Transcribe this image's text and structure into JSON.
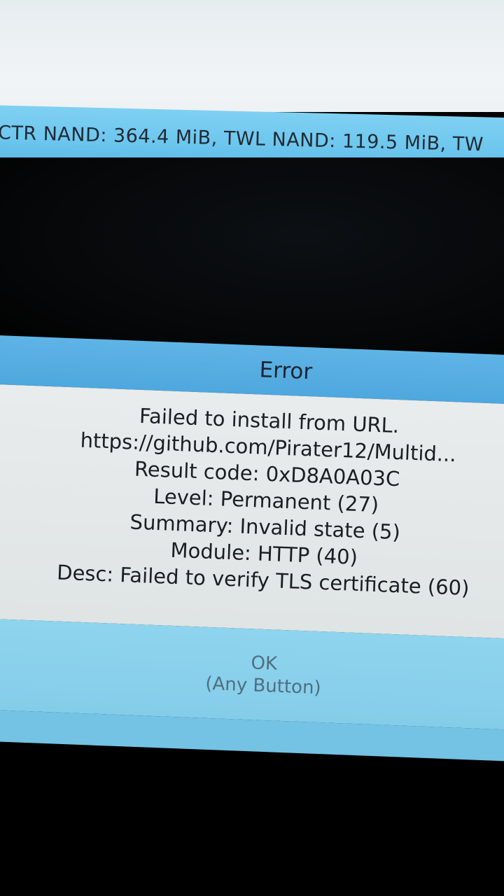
{
  "status_bar": {
    "text": "CTR NAND: 364.4 MiB, TWL NAND: 119.5 MiB, TW"
  },
  "dialog": {
    "title": "Error",
    "lines": [
      "Failed to install from URL.",
      "https://github.com/Pirater12/Multid...",
      "Result code: 0xD8A0A03C",
      "Level: Permanent (27)",
      "Summary: Invalid state (5)",
      "Module: HTTP (40)",
      "Desc: Failed to verify TLS certificate (60)"
    ],
    "button_label": "OK",
    "button_hint": "(Any Button)"
  },
  "colors": {
    "accent_blue": "#5fb4e6",
    "button_blue": "#8fd4ee",
    "dialog_body": "#e9ecec"
  }
}
